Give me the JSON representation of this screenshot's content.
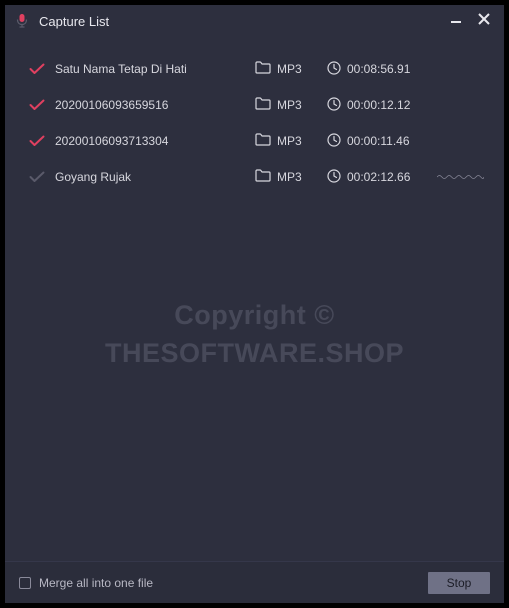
{
  "window": {
    "title": "Capture List"
  },
  "items": [
    {
      "name": "Satu Nama Tetap Di Hati",
      "format": "MP3",
      "duration": "00:08:56.91",
      "checked": true,
      "recording": false
    },
    {
      "name": "20200106093659516",
      "format": "MP3",
      "duration": "00:00:12.12",
      "checked": true,
      "recording": false
    },
    {
      "name": "20200106093713304",
      "format": "MP3",
      "duration": "00:00:11.46",
      "checked": true,
      "recording": false
    },
    {
      "name": "Goyang Rujak",
      "format": "MP3",
      "duration": "00:02:12.66",
      "checked": false,
      "recording": true
    }
  ],
  "watermark": {
    "line1": "Copyright ©",
    "line2": "THESOFTWARE.SHOP"
  },
  "footer": {
    "merge_label": "Merge all into one file",
    "stop_label": "Stop"
  },
  "colors": {
    "accent": "#e04060"
  }
}
